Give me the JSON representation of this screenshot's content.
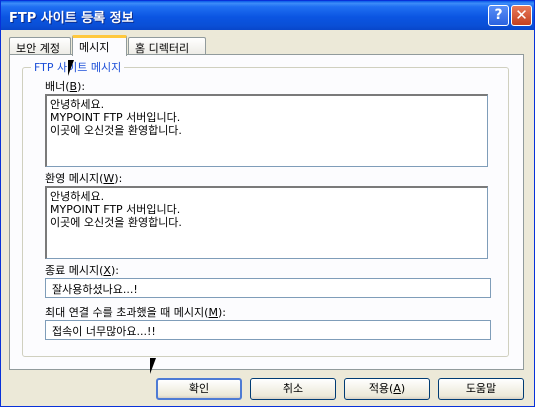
{
  "window": {
    "title": "FTP 사이트 등록 정보"
  },
  "titlebar_buttons": {
    "help": "?",
    "close": "✕"
  },
  "tabs": [
    {
      "label": "보안 계정"
    },
    {
      "label": "메시지"
    },
    {
      "label": "홈 디렉터리"
    }
  ],
  "group": {
    "title": "FTP 사이트 메시지"
  },
  "fields": {
    "banner": {
      "label_pre": "배너(",
      "mnemonic": "B",
      "label_post": "):",
      "value": "안녕하세요.\nMYPOINT FTP 서버입니다.\n이곳에 오신것을 환영합니다."
    },
    "welcome": {
      "label_pre": "환영 메시지(",
      "mnemonic": "W",
      "label_post": "):",
      "value": "안녕하세요.\nMYPOINT FTP 서버입니다.\n이곳에 오신것을 환영합니다."
    },
    "exit": {
      "label_pre": "종료 메시지(",
      "mnemonic": "X",
      "label_post": "):",
      "value": "잘사용하셨나요...!"
    },
    "max_connections": {
      "label_pre": "최대 연결 수를 초과했을 때 메시지(",
      "mnemonic": "M",
      "label_post": "):",
      "value": "접속이 너무많아요...!!"
    }
  },
  "buttons": {
    "ok": "확인",
    "cancel": "취소",
    "apply_pre": "적용(",
    "apply_mnemonic": "A",
    "apply_post": ")",
    "help": "도움말"
  },
  "colors": {
    "titlebar": "#0a55e2",
    "group_title": "#1c4fd8",
    "tab_highlight": "#ffc83c",
    "close_button": "#c4401f"
  }
}
